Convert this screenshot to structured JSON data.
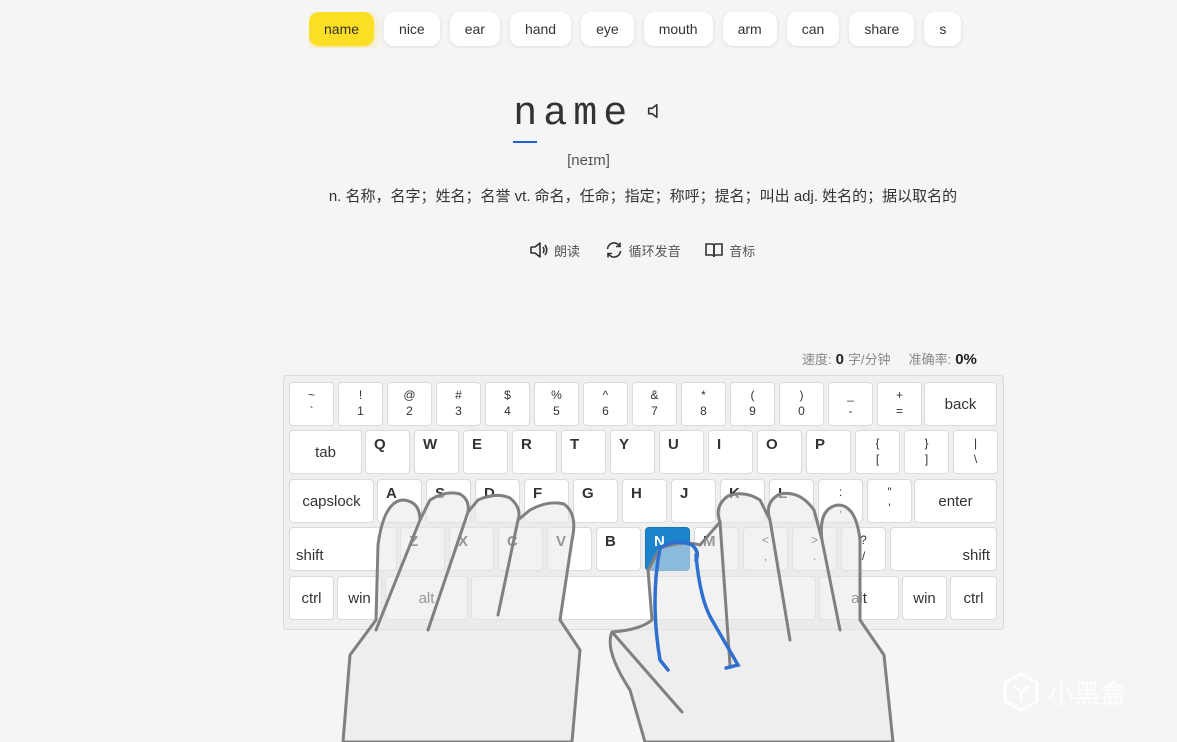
{
  "words": [
    "name",
    "nice",
    "ear",
    "hand",
    "eye",
    "mouth",
    "arm",
    "can",
    "share",
    "s"
  ],
  "current": {
    "word": "name",
    "phonetic": "[neɪm]",
    "definition": "n. 名称，名字；姓名；名誉 vt. 命名，任命；指定；称呼；提名；叫出 adj. 姓名的；据以取名的"
  },
  "controls": {
    "read": "朗读",
    "loop": "循环发音",
    "phonetic": "音标"
  },
  "stats": {
    "speed_label": "速度:",
    "speed_value": "0",
    "speed_unit": "字/分钟",
    "accuracy_label": "准确率:",
    "accuracy_value": "0%"
  },
  "keyboard": {
    "row1": [
      [
        "~",
        "`"
      ],
      [
        "!",
        "1"
      ],
      [
        "@",
        "2"
      ],
      [
        "#",
        "3"
      ],
      [
        "$",
        "4"
      ],
      [
        "%",
        "5"
      ],
      [
        "^",
        "6"
      ],
      [
        "&",
        "7"
      ],
      [
        "*",
        "8"
      ],
      [
        "(",
        "9"
      ],
      [
        ")",
        "0"
      ],
      [
        "_",
        "-"
      ],
      [
        "+",
        "="
      ]
    ],
    "row1_back": "back",
    "row2_tab": "tab",
    "row2": [
      "Q",
      "W",
      "E",
      "R",
      "T",
      "Y",
      "U",
      "I",
      "O",
      "P"
    ],
    "row2_sym": [
      [
        "{",
        "["
      ],
      [
        "}",
        "]"
      ],
      [
        "|",
        "\\"
      ]
    ],
    "row3_caps": "capslock",
    "row3": [
      "A",
      "S",
      "D",
      "F",
      "G",
      "H",
      "J",
      "K",
      "L"
    ],
    "row3_sym": [
      [
        ":",
        ";"
      ],
      [
        "\"",
        "'"
      ]
    ],
    "row3_enter": "enter",
    "row4_shift": "shift",
    "row4": [
      "Z",
      "X",
      "C",
      "V",
      "B",
      "N",
      "M"
    ],
    "row4_sym": [
      [
        "<",
        ","
      ],
      [
        ">",
        "."
      ],
      [
        "?",
        "/"
      ]
    ],
    "row5": [
      "ctrl",
      "win",
      "alt",
      "alt",
      "win",
      "ctrl"
    ],
    "highlight": "N"
  },
  "watermark": "小黑盒",
  "colors": {
    "active_chip": "#fadf24",
    "highlight_key": "#1b84ca",
    "finger_line": "#2f6fd0",
    "cursor": "#1f5ed6"
  }
}
